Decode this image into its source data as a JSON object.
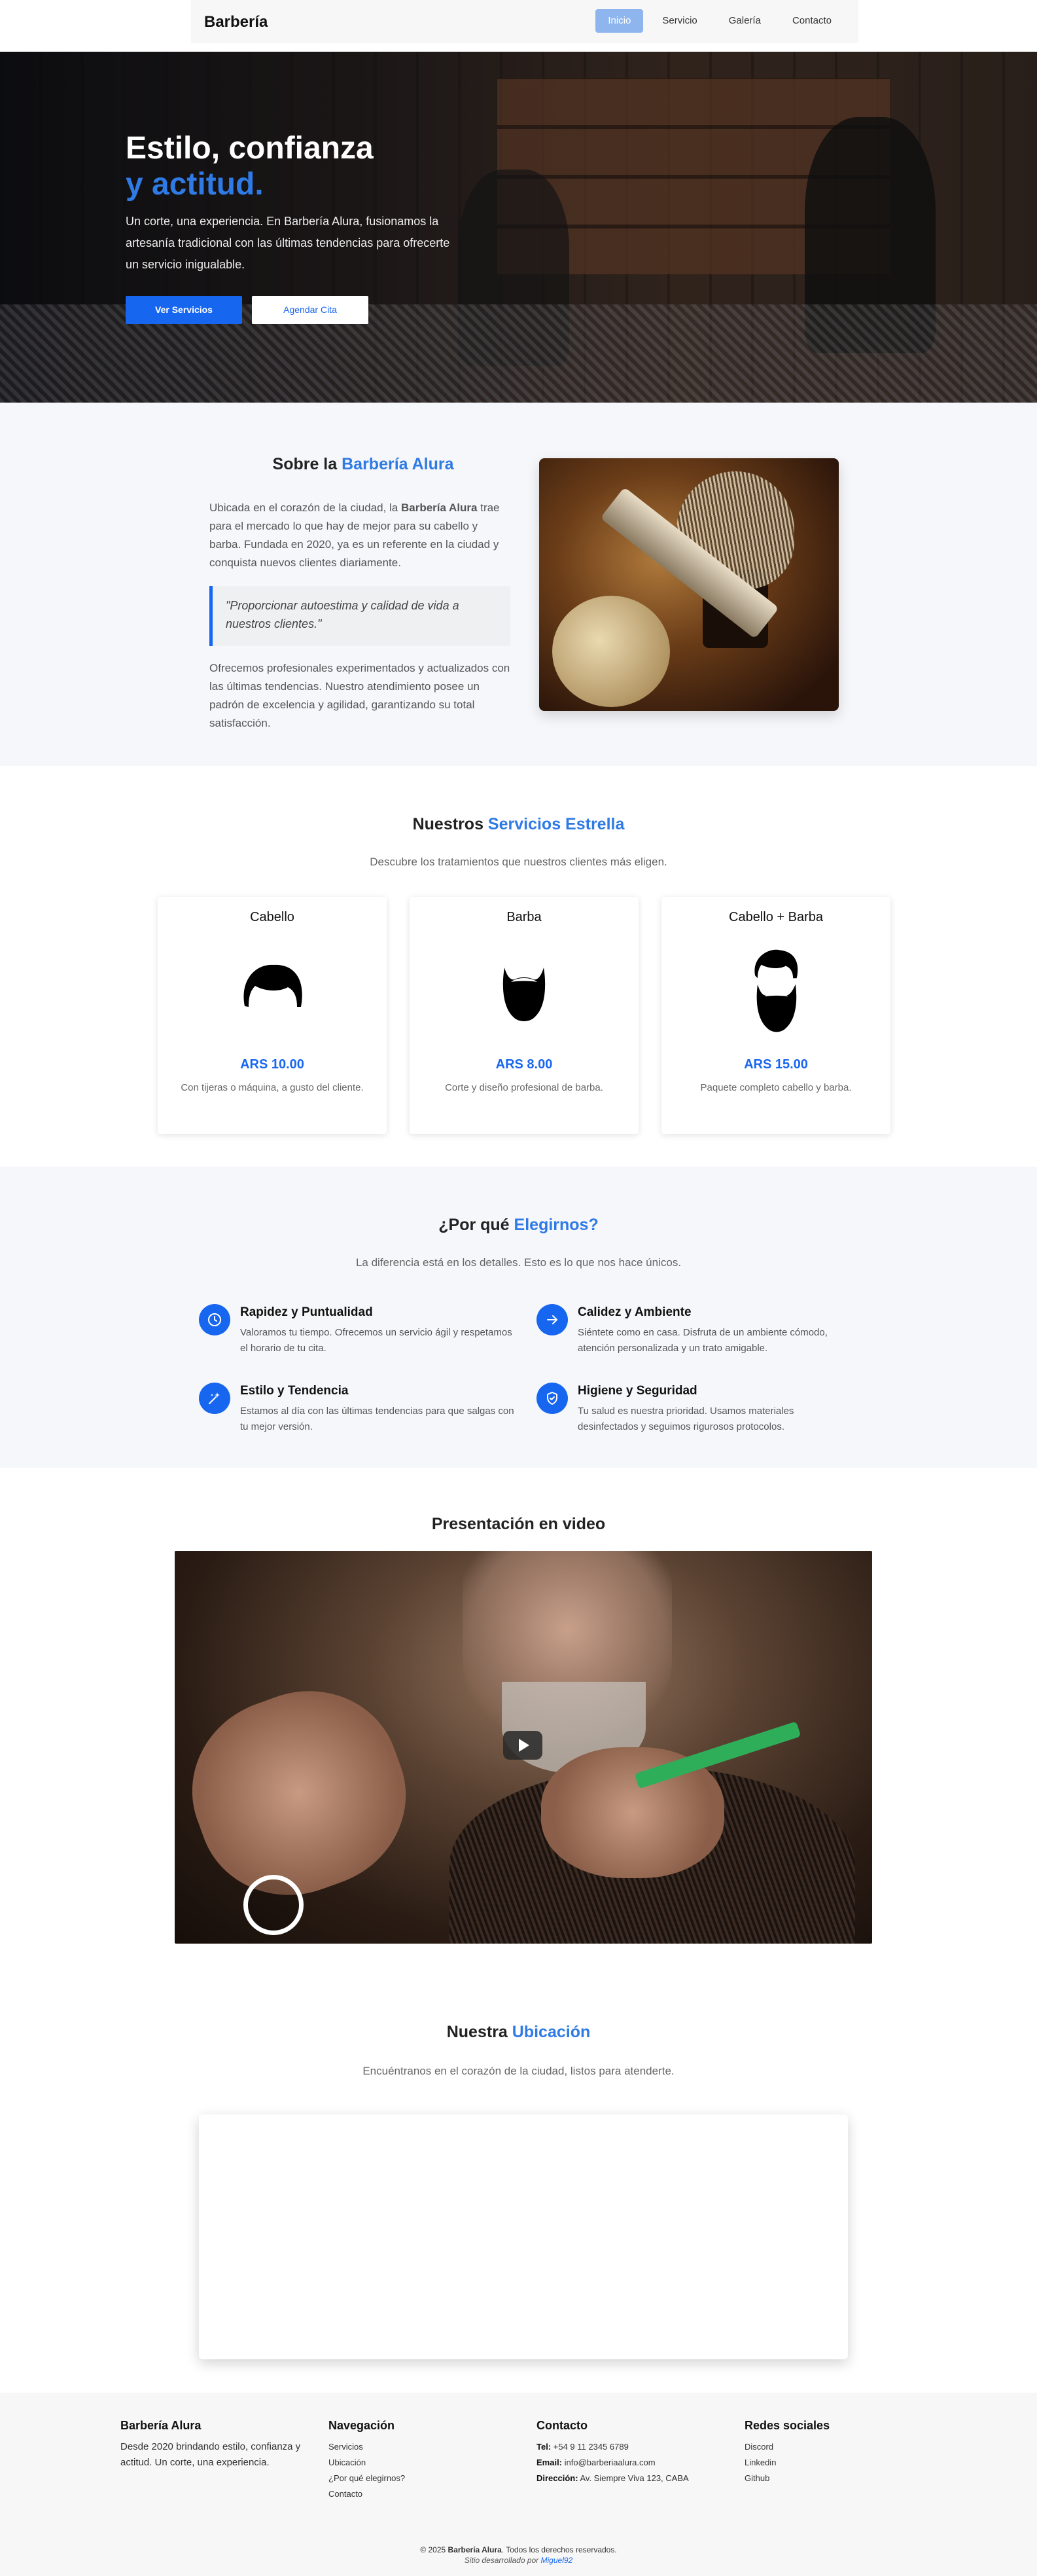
{
  "navbar": {
    "brand": "Barbería",
    "links": [
      "Inicio",
      "Servicio",
      "Galería",
      "Contacto"
    ]
  },
  "hero": {
    "title_line1": "Estilo, confianza",
    "title_line2": "y actitud.",
    "text": "Un corte, una experiencia. En Barbería Alura, fusionamos la artesanía tradicional con las últimas tendencias para ofrecerte un servicio inigualable.",
    "btn_services": "Ver Servicios",
    "btn_booking": "Agendar Cita"
  },
  "about": {
    "title_prefix": "Sobre la ",
    "title_highlight": "Barbería Alura",
    "p1_before": "Ubicada en el corazón de la ciudad, la ",
    "p1_bold": "Barbería Alura",
    "p1_after": " trae para el mercado lo que hay de mejor para su cabello y barba. Fundada en 2020, ya es un referente en la ciudad y conquista nuevos clientes diariamente.",
    "quote": "\"Proporcionar autoestima y calidad de vida a nuestros clientes.\"",
    "p2": "Ofrecemos profesionales experimentados y actualizados con las últimas tendencias. Nuestro atendimiento posee un padrón de excelencia y agilidad, garantizando su total satisfacción."
  },
  "services": {
    "title_prefix": "Nuestros ",
    "title_highlight": "Servicios Estrella",
    "subtitle": "Descubre los tratamientos que nuestros clientes más eligen.",
    "cards": [
      {
        "title": "Cabello",
        "icon": "hair-icon",
        "price": "ARS 10.00",
        "desc": "Con tijeras o máquina, a gusto del cliente."
      },
      {
        "title": "Barba",
        "icon": "beard-icon",
        "price": "ARS 8.00",
        "desc": "Corte y diseño profesional de barba."
      },
      {
        "title": "Cabello + Barba",
        "icon": "hair-beard-icon",
        "price": "ARS 15.00",
        "desc": "Paquete completo cabello y barba."
      }
    ]
  },
  "why": {
    "title_prefix": "¿Por qué ",
    "title_highlight": "Elegirnos?",
    "subtitle": "La diferencia está en los detalles. Esto es lo que nos hace únicos.",
    "features": [
      {
        "icon": "clock-icon",
        "title": "Rapidez y Puntualidad",
        "desc": "Valoramos tu tiempo. Ofrecemos un servicio ágil y respetamos el horario de tu cita."
      },
      {
        "icon": "arrow-right-icon",
        "title": "Calidez y Ambiente",
        "desc": "Siéntete como en casa. Disfruta de un ambiente cómodo, atención personalizada y un trato amigable."
      },
      {
        "icon": "sparkles-icon",
        "title": "Estilo y Tendencia",
        "desc": "Estamos al día con las últimas tendencias para que salgas con tu mejor versión."
      },
      {
        "icon": "shield-check-icon",
        "title": "Higiene y Seguridad",
        "desc": "Tu salud es nuestra prioridad. Usamos materiales desinfectados y seguimos rigurosos protocolos."
      }
    ]
  },
  "video": {
    "title": "Presentación en video"
  },
  "location": {
    "title_prefix": "Nuestra ",
    "title_highlight": "Ubicación",
    "subtitle": "Encuéntranos en el corazón de la ciudad, listos para atenderte."
  },
  "footer": {
    "brand": "Barbería Alura",
    "brand_text": "Desde 2020 brindando estilo, confianza y actitud. Un corte, una experiencia.",
    "nav_title": "Navegación",
    "nav_links": [
      "Servicios",
      "Ubicación",
      "¿Por qué elegirnos?",
      "Contacto"
    ],
    "contact_title": "Contacto",
    "contact": [
      {
        "label": "Tel:",
        "value": " +54 9 11 2345 6789"
      },
      {
        "label": "Email:",
        "value": " info@barberiaalura.com"
      },
      {
        "label": "Dirección:",
        "value": " Av. Siempre Viva 123, CABA"
      }
    ],
    "social_title": "Redes sociales",
    "social_links": [
      "Discord",
      "Linkedin",
      "Github"
    ],
    "copyright_prefix": "© 2025 ",
    "copyright_brand": "Barbería Alura",
    "copyright_suffix": ". Todos los derechos reservados.",
    "dev_prefix": "Sitio desarrollado por ",
    "dev_name": "Miguel92"
  },
  "colors": {
    "accent": "#1766f0",
    "highlight": "#2f7ae5",
    "nav_active": "#8eb5ee"
  }
}
